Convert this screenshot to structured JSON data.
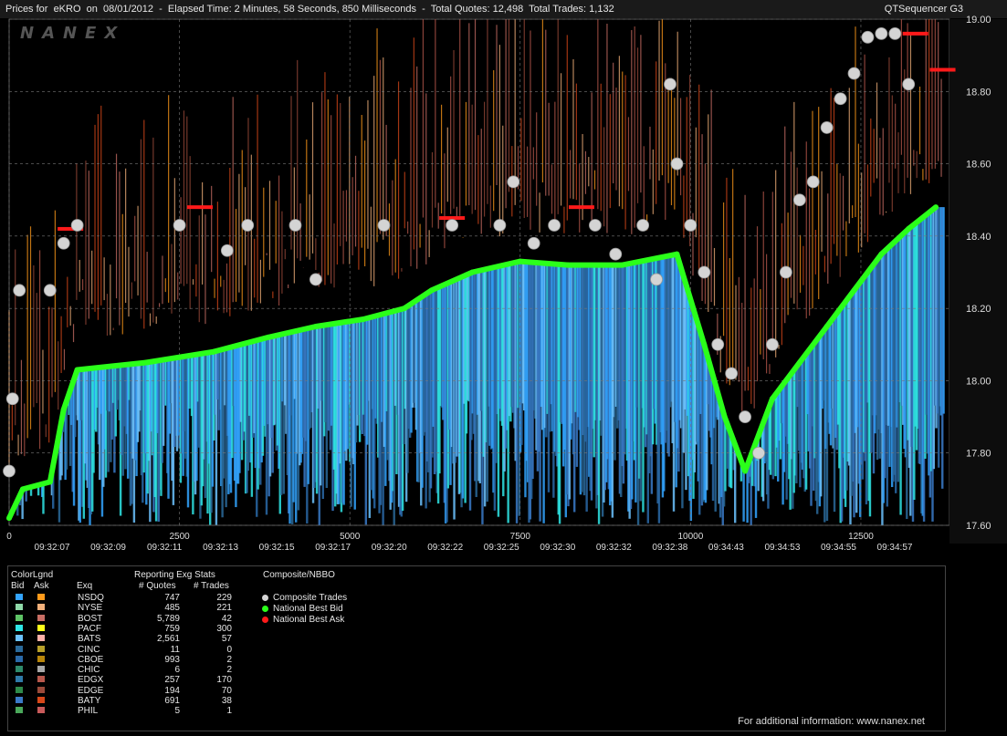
{
  "header": {
    "title": "Prices for  eKRO  on  08/01/2012  -  Elapsed Time: 2 Minutes, 58 Seconds, 850 Milliseconds  -  Total Quotes: 12,498  Total Trades: 1,132",
    "app_name": "QTSequencer G3",
    "watermark": "NANEX"
  },
  "chart_data": {
    "type": "scatter",
    "y_ticks": [
      "19.00",
      "18.80",
      "18.60",
      "18.40",
      "18.20",
      "18.00",
      "17.80",
      "17.60"
    ],
    "ylim": [
      17.6,
      19.0
    ],
    "x_ticks": [
      "0",
      "2500",
      "5000",
      "7500",
      "10000",
      "12500"
    ],
    "xlim": [
      0,
      13800
    ],
    "time_labels": [
      "09:32:07",
      "09:32:09",
      "09:32:11",
      "09:32:13",
      "09:32:15",
      "09:32:17",
      "09:32:20",
      "09:32:22",
      "09:32:25",
      "09:32:30",
      "09:32:32",
      "09:32:38",
      "09:34:43",
      "09:34:53",
      "09:34:55",
      "09:34:57"
    ],
    "series": [
      {
        "name": "Composite Trades",
        "color": "#d4d4d4",
        "points": [
          [
            0,
            17.75
          ],
          [
            50,
            17.95
          ],
          [
            150,
            18.25
          ],
          [
            600,
            18.25
          ],
          [
            800,
            18.38
          ],
          [
            1000,
            18.43
          ],
          [
            2500,
            18.43
          ],
          [
            3200,
            18.36
          ],
          [
            3500,
            18.43
          ],
          [
            4200,
            18.43
          ],
          [
            4500,
            18.28
          ],
          [
            5500,
            18.43
          ],
          [
            6500,
            18.43
          ],
          [
            7200,
            18.43
          ],
          [
            7400,
            18.55
          ],
          [
            7700,
            18.38
          ],
          [
            8000,
            18.43
          ],
          [
            8600,
            18.43
          ],
          [
            8900,
            18.35
          ],
          [
            9300,
            18.43
          ],
          [
            9500,
            18.28
          ],
          [
            9700,
            18.82
          ],
          [
            9800,
            18.6
          ],
          [
            10000,
            18.43
          ],
          [
            10200,
            18.3
          ],
          [
            10400,
            18.1
          ],
          [
            10600,
            18.02
          ],
          [
            10800,
            17.9
          ],
          [
            11000,
            17.8
          ],
          [
            11200,
            18.1
          ],
          [
            11400,
            18.3
          ],
          [
            11600,
            18.5
          ],
          [
            11800,
            18.55
          ],
          [
            12000,
            18.7
          ],
          [
            12200,
            18.78
          ],
          [
            12400,
            18.85
          ],
          [
            12600,
            18.95
          ],
          [
            12800,
            18.96
          ],
          [
            13000,
            18.96
          ],
          [
            13200,
            18.82
          ]
        ]
      },
      {
        "name": "National Best Bid",
        "color": "#2bff1a",
        "points": [
          [
            0,
            17.62
          ],
          [
            200,
            17.7
          ],
          [
            600,
            17.72
          ],
          [
            800,
            17.92
          ],
          [
            1000,
            18.03
          ],
          [
            2000,
            18.05
          ],
          [
            3000,
            18.08
          ],
          [
            3800,
            18.12
          ],
          [
            4500,
            18.15
          ],
          [
            5200,
            18.17
          ],
          [
            5800,
            18.2
          ],
          [
            6200,
            18.25
          ],
          [
            6800,
            18.3
          ],
          [
            7500,
            18.33
          ],
          [
            8200,
            18.32
          ],
          [
            9000,
            18.32
          ],
          [
            9800,
            18.35
          ],
          [
            10200,
            18.1
          ],
          [
            10500,
            17.9
          ],
          [
            10800,
            17.75
          ],
          [
            11200,
            17.95
          ],
          [
            11600,
            18.05
          ],
          [
            12000,
            18.15
          ],
          [
            12400,
            18.25
          ],
          [
            12800,
            18.35
          ],
          [
            13200,
            18.42
          ],
          [
            13600,
            18.48
          ]
        ]
      },
      {
        "name": "National Best Ask",
        "color": "#ff1a1a",
        "points": [
          [
            900,
            18.42
          ],
          [
            2800,
            18.48
          ],
          [
            6500,
            18.45
          ],
          [
            8400,
            18.48
          ],
          [
            13300,
            18.96
          ],
          [
            13700,
            18.86
          ]
        ]
      }
    ]
  },
  "legend": {
    "color_legend_title": "ColorLgnd",
    "bid_label": "Bid",
    "ask_label": "Ask",
    "exg_title": "Reporting Exg Stats",
    "col_exq": "Exq",
    "col_quotes": "# Quotes",
    "col_trades": "# Trades",
    "composite_title": "Composite/NBBO",
    "exchanges": [
      {
        "name": "NSDQ",
        "quotes": "747",
        "trades": "229",
        "bid_color": "#33a4ff",
        "ask_color": "#ff9a1a"
      },
      {
        "name": "NYSE",
        "quotes": "485",
        "trades": "221",
        "bid_color": "#8fd9a8",
        "ask_color": "#f2b07a"
      },
      {
        "name": "BOST",
        "quotes": "5,789",
        "trades": "42",
        "bid_color": "#5ec466",
        "ask_color": "#c86e64"
      },
      {
        "name": "PACF",
        "quotes": "759",
        "trades": "300",
        "bid_color": "#2fe6e6",
        "ask_color": "#ffff1a"
      },
      {
        "name": "BATS",
        "quotes": "2,561",
        "trades": "57",
        "bid_color": "#6cc3ff",
        "ask_color": "#ffb0a8"
      },
      {
        "name": "CINC",
        "quotes": "11",
        "trades": "0",
        "bid_color": "#2a6a9a",
        "ask_color": "#b8a02a"
      },
      {
        "name": "CBOE",
        "quotes": "993",
        "trades": "2",
        "bid_color": "#2a6aa8",
        "ask_color": "#b8860b"
      },
      {
        "name": "CHIC",
        "quotes": "6",
        "trades": "2",
        "bid_color": "#2e8a6a",
        "ask_color": "#a8a8a8"
      },
      {
        "name": "EDGX",
        "quotes": "257",
        "trades": "170",
        "bid_color": "#2f7aa8",
        "ask_color": "#b8584c"
      },
      {
        "name": "EDGE",
        "quotes": "194",
        "trades": "70",
        "bid_color": "#2e8a4a",
        "ask_color": "#9a4a3a"
      },
      {
        "name": "BATY",
        "quotes": "691",
        "trades": "38",
        "bid_color": "#3a7ac8",
        "ask_color": "#d8481a"
      },
      {
        "name": "PHIL",
        "quotes": "5",
        "trades": "1",
        "bid_color": "#4aa85a",
        "ask_color": "#c85a5a"
      }
    ],
    "composite_items": [
      {
        "label": "Composite Trades",
        "color": "#d4d4d4"
      },
      {
        "label": "National Best Bid",
        "color": "#2bff1a"
      },
      {
        "label": "National Best Ask",
        "color": "#ff1a1a"
      }
    ]
  },
  "footer": {
    "text": "For additional information: www.nanex.net"
  }
}
